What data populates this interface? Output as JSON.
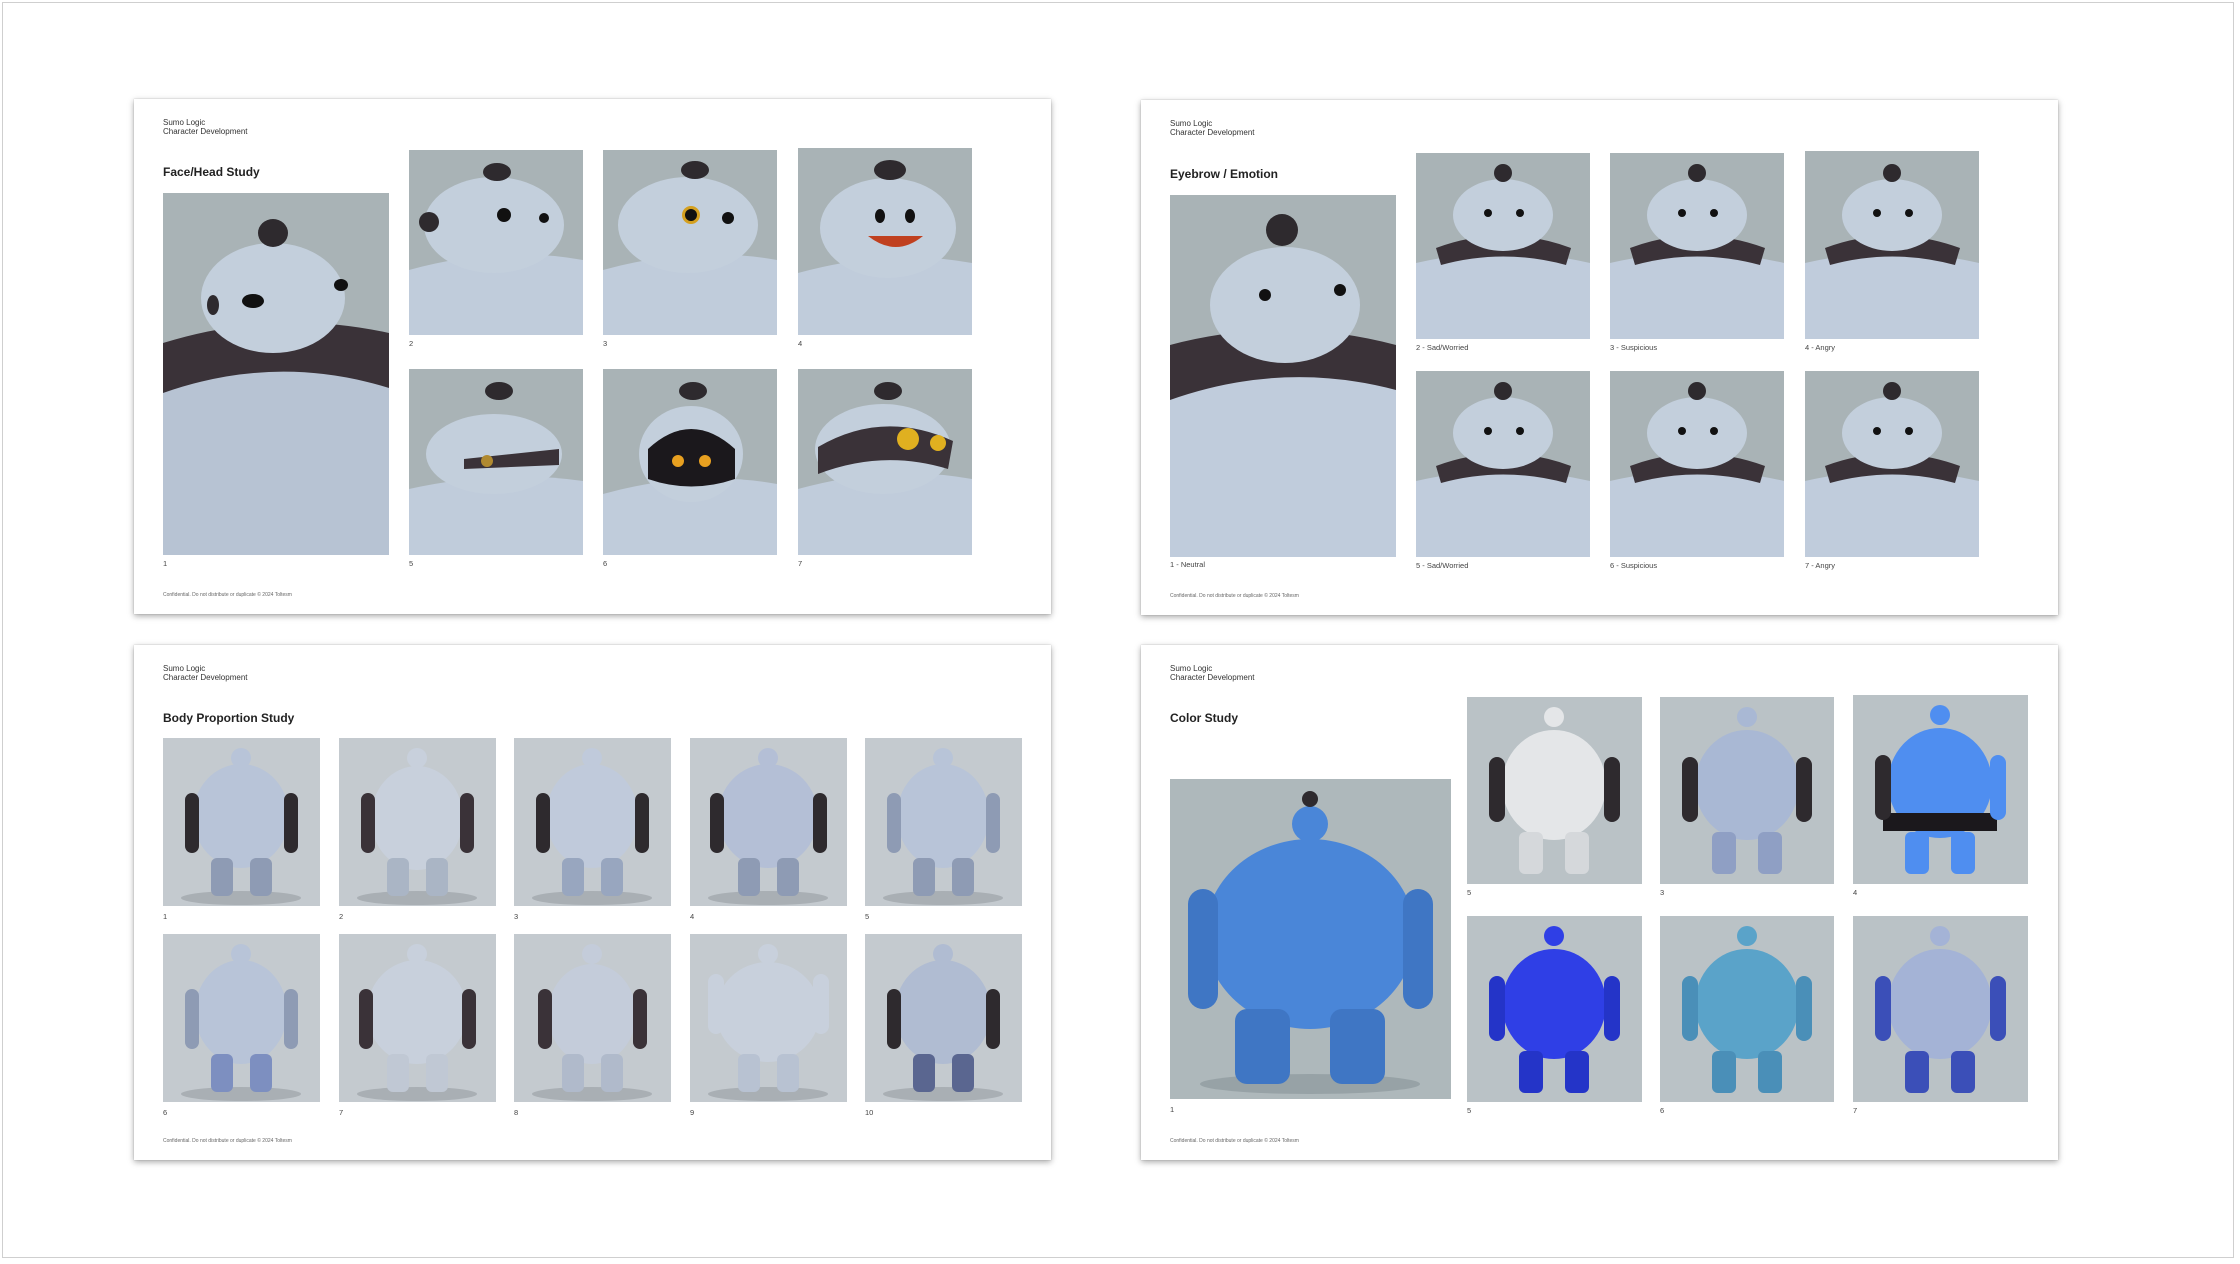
{
  "slides": [
    {
      "id": "s1",
      "brand_line1": "Sumo Logic",
      "brand_line2": "Character Development",
      "title": "Face/Head Study",
      "footer": "Confidential. Do not distribute or duplicate © 2024 Toltesm",
      "captions": [
        "1",
        "2",
        "3",
        "4",
        "5",
        "6",
        "7"
      ]
    },
    {
      "id": "s2",
      "brand_line1": "Sumo Logic",
      "brand_line2": "Character Development",
      "title": "Eyebrow / Emotion",
      "footer": "Confidential. Do not distribute or duplicate © 2024 Toltesm",
      "captions": [
        "1 - Neutral",
        "2 - Sad/Worried",
        "3 - Suspicious",
        "4 - Angry",
        "5 - Sad/Worried",
        "6 - Suspicious",
        "7 - Angry"
      ]
    },
    {
      "id": "s3",
      "brand_line1": "Sumo Logic",
      "brand_line2": "Character Development",
      "title": "Body Proportion Study",
      "footer": "Confidential. Do not distribute or duplicate © 2024 Toltesm",
      "captions": [
        "1",
        "2",
        "3",
        "4",
        "5",
        "6",
        "7",
        "8",
        "9",
        "10"
      ]
    },
    {
      "id": "s4",
      "brand_line1": "Sumo Logic",
      "brand_line2": "Character Development",
      "title": "Color Study",
      "footer": "Confidential. Do not distribute or duplicate © 2024 Toltesm",
      "captions": [
        "1",
        "5",
        "3",
        "4",
        "5",
        "6",
        "7"
      ]
    }
  ],
  "colors": {
    "photo_bg": "#a9b3b6",
    "robot_pale": "#b9c7da",
    "robot_white": "#e4e6e8",
    "robot_blue": "#4a86d8",
    "robot_royal": "#2f3fe6",
    "robot_teal": "#5aa3c9",
    "robot_sky": "#4f8ef0",
    "dark": "#2e2a2e"
  }
}
